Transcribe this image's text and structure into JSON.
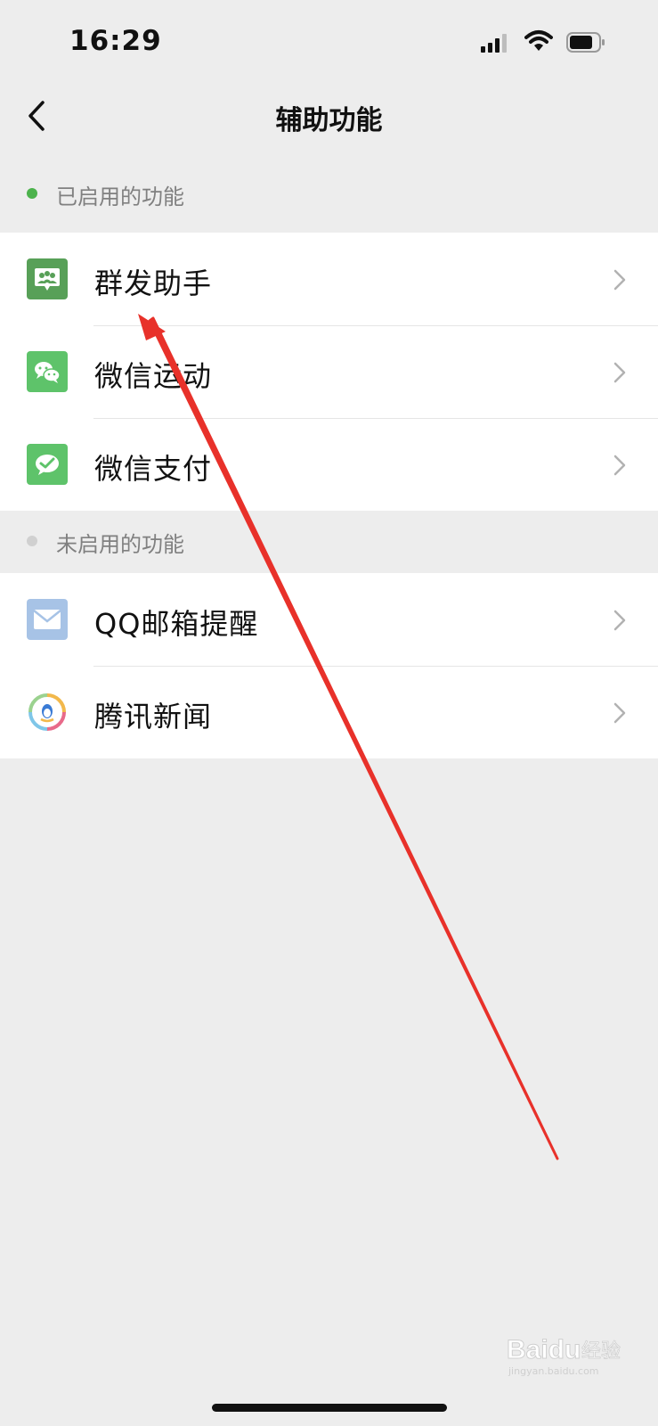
{
  "status_bar": {
    "time": "16:29"
  },
  "nav": {
    "title": "辅助功能"
  },
  "enabled_section": {
    "label": "已启用的功能",
    "items": [
      {
        "label": "群发助手",
        "icon": "mass-message-icon"
      },
      {
        "label": "微信运动",
        "icon": "wechat-sport-icon"
      },
      {
        "label": "微信支付",
        "icon": "wechat-pay-icon"
      }
    ]
  },
  "disabled_section": {
    "label": "未启用的功能",
    "items": [
      {
        "label": "QQ邮箱提醒",
        "icon": "mail-icon"
      },
      {
        "label": "腾讯新闻",
        "icon": "tencent-news-icon"
      }
    ]
  },
  "watermark": {
    "text": "Baidu经验",
    "subtext": "jingyan.baidu.com"
  },
  "colors": {
    "background": "#ededed",
    "enabled_dot": "#4cb24c",
    "disabled_dot": "#d0d0d0",
    "mass_icon": "#58a058",
    "sport_icon": "#5ec36a",
    "pay_icon": "#5ec36a",
    "mail_icon": "#a7c3e6",
    "arrow": "#e8312a"
  }
}
